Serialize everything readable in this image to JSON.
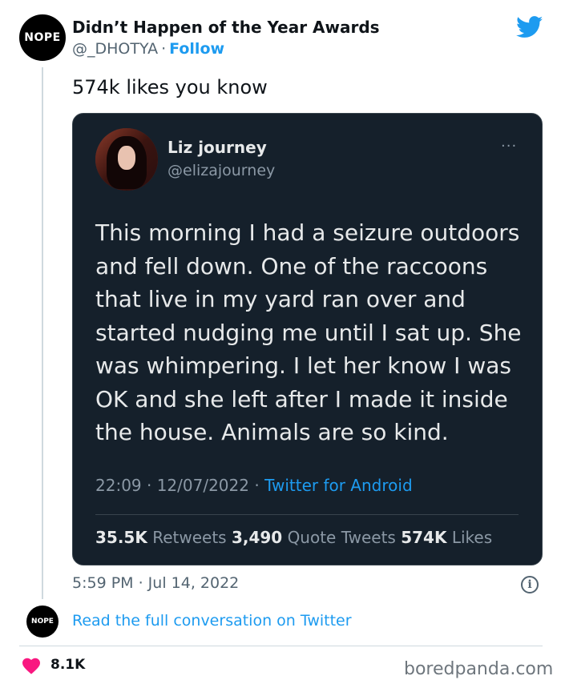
{
  "author": {
    "avatar_text": "NOPE",
    "display_name": "Didn’t Happen of the Year Awards",
    "handle": "@_DHOTYA",
    "separator": "·",
    "follow_label": "Follow"
  },
  "icons": {
    "brand": "twitter-bird-icon",
    "info": "info-icon",
    "like": "heart-icon"
  },
  "tweet": {
    "text": "574k likes you know",
    "timestamp": "5:59 PM · Jul 14, 2022",
    "info_glyph": "i"
  },
  "quoted_tweet": {
    "display_name": "Liz journey",
    "handle": "@elizajourney",
    "more": "···",
    "body": "This morning I had a seizure outdoors and fell down. One of the raccoons that live in my yard ran over and started nudging me until I sat up. She was whimpering. I let her know I was OK and she left after I made it inside the house. Animals are so kind.",
    "time_date": "22:09 · 12/07/2022 ·",
    "source": "Twitter for Android",
    "stats": {
      "retweets_value": "35.5K",
      "retweets_label": "Retweets",
      "quotes_value": "3,490",
      "quotes_label": "Quote Tweets",
      "likes_value": "574K",
      "likes_label": "Likes"
    }
  },
  "footer": {
    "small_avatar_text": "NOPE",
    "read_link": "Read the full conversation on Twitter",
    "like_count": "8.1K",
    "watermark": "boredpanda.com"
  },
  "colors": {
    "twitter_blue": "#1d9bf0",
    "embed_bg": "#15202b",
    "heart": "#f91880"
  }
}
